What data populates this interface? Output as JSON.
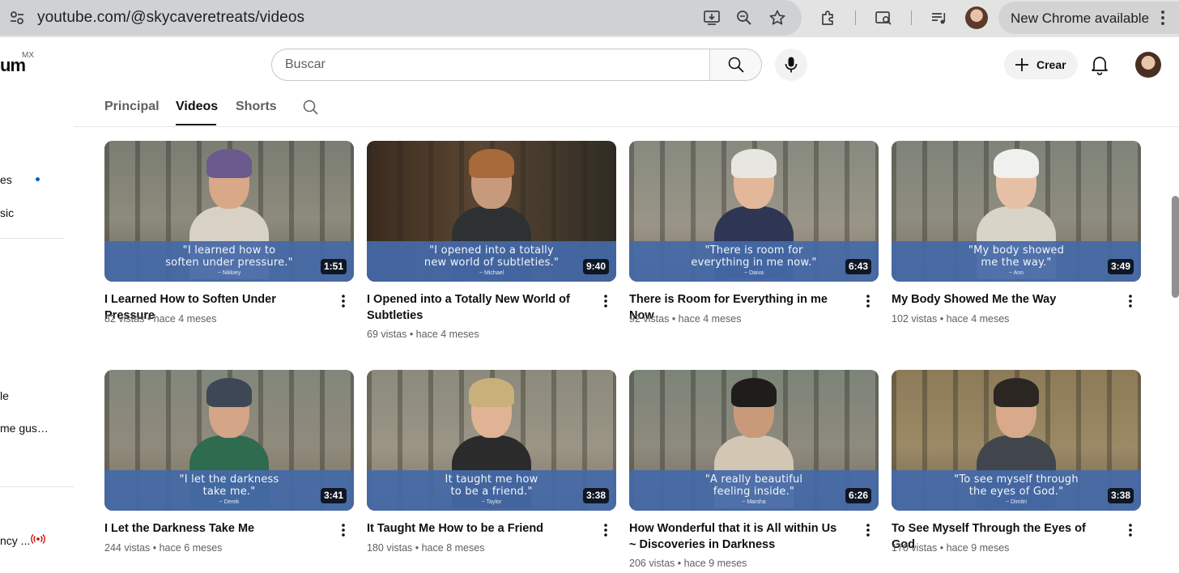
{
  "browser": {
    "url": "youtube.com/@skycaveretreats/videos",
    "update_label": "New Chrome available"
  },
  "header": {
    "logo_fragment": "um",
    "region": "MX",
    "search_placeholder": "Buscar",
    "create_label": "Crear"
  },
  "sidebar": {
    "fragments": [
      "es",
      "sic",
      "le",
      "me gus…",
      "ncy ..."
    ]
  },
  "tabs": [
    {
      "label": "Principal",
      "active": false
    },
    {
      "label": "Videos",
      "active": true
    },
    {
      "label": "Shorts",
      "active": false
    }
  ],
  "videos": [
    {
      "title": "I Learned How to Soften Under Pressure",
      "views": "82 vistas",
      "age": "hace 4 meses",
      "duration": "1:51",
      "quote_line1": "\"I learned how to",
      "quote_line2": "soften under pressure.\"",
      "author": "~ Nikkiey"
    },
    {
      "title": "I Opened into a Totally New World of Subtleties",
      "views": "69 vistas",
      "age": "hace 4 meses",
      "duration": "9:40",
      "quote_line1": "\"I opened into a totally",
      "quote_line2": "new world of subtleties.\"",
      "author": "~ Michael"
    },
    {
      "title": "There is Room for Everything in me Now",
      "views": "92 vistas",
      "age": "hace 4 meses",
      "duration": "6:43",
      "quote_line1": "\"There is room for",
      "quote_line2": "everything in me now.\"",
      "author": "~ Daiva"
    },
    {
      "title": "My Body Showed Me the Way",
      "views": "102 vistas",
      "age": "hace 4 meses",
      "duration": "3:49",
      "quote_line1": "\"My body showed",
      "quote_line2": "me the way.\"",
      "author": "~ Ann"
    },
    {
      "title": "I Let the Darkness Take Me",
      "views": "244 vistas",
      "age": "hace 6 meses",
      "duration": "3:41",
      "quote_line1": "\"I let the darkness",
      "quote_line2": "take me.\"",
      "author": "~ Derek"
    },
    {
      "title": "It Taught Me How to be a Friend",
      "views": "180 vistas",
      "age": "hace 8 meses",
      "duration": "3:38",
      "quote_line1": "It taught me how",
      "quote_line2": "to be a friend.\"",
      "author": "~ Taylor"
    },
    {
      "title": "How Wonderful that it is All within Us ~ Discoveries in Darkness",
      "views": "206 vistas",
      "age": "hace 9 meses",
      "duration": "6:26",
      "quote_line1": "\"A really beautiful",
      "quote_line2": "feeling inside.\"",
      "author": "~ Marsha"
    },
    {
      "title": "To See Myself Through the Eyes of God",
      "views": "170 vistas",
      "age": "hace 9 meses",
      "duration": "3:38",
      "quote_line1": "\"To see myself through",
      "quote_line2": "the eyes of God.\"",
      "author": "~ Dimitri"
    }
  ],
  "icons": {
    "site_settings": "tune-icon",
    "install": "install-app-icon",
    "zoom": "zoom-icon",
    "bookmark": "star-icon",
    "extensions": "puzzle-icon",
    "tab_search": "tab-search-icon",
    "media": "media-control-icon",
    "search": "search-icon",
    "mic": "mic-icon",
    "create": "plus-icon",
    "notifications": "bell-icon",
    "live": "live-icon",
    "more": "more-vert-icon"
  },
  "colors": {
    "banner": "#4569a8",
    "link_dot": "#065fd4",
    "live": "#cc0000"
  }
}
